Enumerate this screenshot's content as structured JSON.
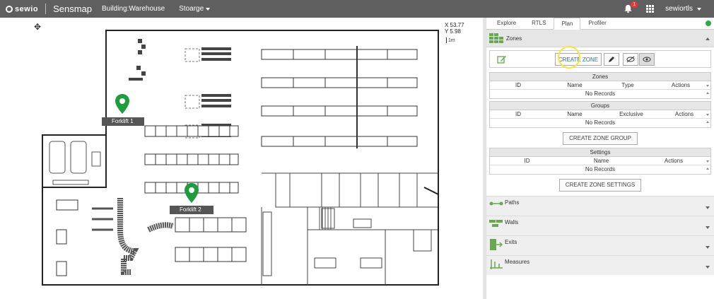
{
  "header": {
    "logo": "sewio",
    "app_name": "Sensmap",
    "building": "Building:Warehouse",
    "floor": "Stoarge",
    "notification_count": "1",
    "username": "sewiortls"
  },
  "map": {
    "coord_x": "X 53.77",
    "coord_y": "Y 5.98",
    "scale_label": "1m",
    "markers": [
      {
        "label": "Forklift 1"
      },
      {
        "label": "Forklift 2"
      }
    ],
    "marker_color": "#1e9c3e"
  },
  "panel": {
    "tabs": [
      "Explore",
      "RTLS",
      "Plan",
      "Profiler"
    ],
    "active_tab": "Plan",
    "zones_section": "Zones",
    "create_zone_label": "CREATE ZONE",
    "zones_table": {
      "title": "Zones",
      "columns": [
        "ID",
        "Name",
        "Type",
        "Actions"
      ],
      "empty": "No Records"
    },
    "groups_table": {
      "title": "Groups",
      "columns": [
        "ID",
        "Name",
        "Exclusive",
        "Actions"
      ],
      "empty": "No Records"
    },
    "create_group_label": "CREATE ZONE GROUP",
    "settings_table": {
      "title": "Settings",
      "columns": [
        "ID",
        "Name",
        "Actions"
      ],
      "empty": "No Records"
    },
    "create_settings_label": "CREATE ZONE SETTINGS",
    "sections": [
      {
        "label": "Paths",
        "icon": "paths-icon"
      },
      {
        "label": "Walls",
        "icon": "walls-icon"
      },
      {
        "label": "Exits",
        "icon": "exits-icon"
      },
      {
        "label": "Measures",
        "icon": "measures-icon"
      }
    ],
    "accent_color": "#6aa84f"
  }
}
